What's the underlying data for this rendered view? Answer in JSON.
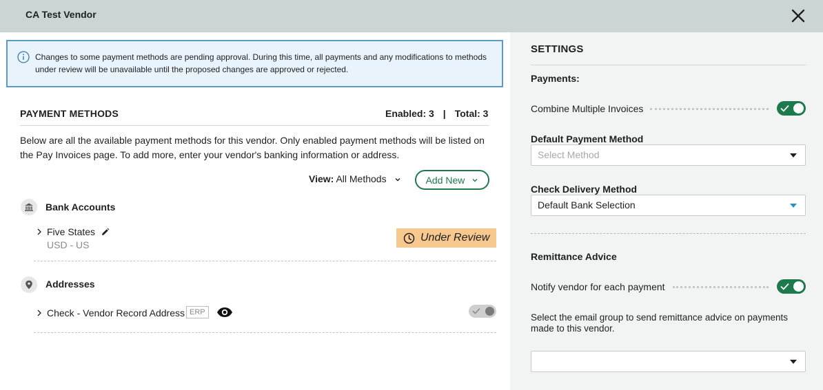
{
  "header": {
    "title": "CA Test Vendor",
    "close_icon": "close-icon"
  },
  "banner": {
    "icon": "info-icon",
    "text": "Changes to some payment methods are pending approval. During this time, all payments and any modifications to methods under review will be unavailable until the proposed changes are approved or rejected."
  },
  "payment_methods": {
    "title": "PAYMENT METHODS",
    "enabled": "Enabled: 3",
    "separator": "|",
    "total": "Total: 3",
    "description": "Below are all the available payment methods for this vendor. Only enabled payment methods will be listed on the Pay Invoices page. To add more, enter your vendor's banking information or address.",
    "view_label": "View:",
    "view_value": "All Methods",
    "add_new_label": "Add New",
    "bank_accounts": {
      "title": "Bank Accounts",
      "icon": "bank-icon",
      "items": [
        {
          "name": "Five States",
          "sub": "USD - US",
          "badge": "Under Review",
          "badge_icon": "clock-icon"
        }
      ]
    },
    "addresses": {
      "title": "Addresses",
      "icon": "location-pin-icon",
      "items": [
        {
          "name": "Check - Vendor Record Address",
          "tag": "ERP",
          "enabled": true
        }
      ]
    }
  },
  "settings": {
    "title": "SETTINGS",
    "payments_label": "Payments:",
    "combine_invoices_label": "Combine Multiple Invoices",
    "combine_invoices_on": true,
    "default_payment_method_label": "Default Payment Method",
    "default_payment_method_placeholder": "Select Method",
    "check_delivery_label": "Check Delivery Method",
    "check_delivery_value": "Default Bank Selection",
    "remittance_label": "Remittance Advice",
    "notify_vendor_label": "Notify vendor for each payment",
    "notify_vendor_on": true,
    "email_group_text": "Select the email group to send remittance advice on payments made to this vendor.",
    "email_group_value": ""
  },
  "colors": {
    "header_bg": "#ccd5d6",
    "accent_green": "#1d7a4c",
    "banner_border": "#5b9ac4",
    "banner_bg": "#e8f3fb",
    "review_badge": "#f8c98f",
    "settings_bg": "#f2f4f4"
  }
}
